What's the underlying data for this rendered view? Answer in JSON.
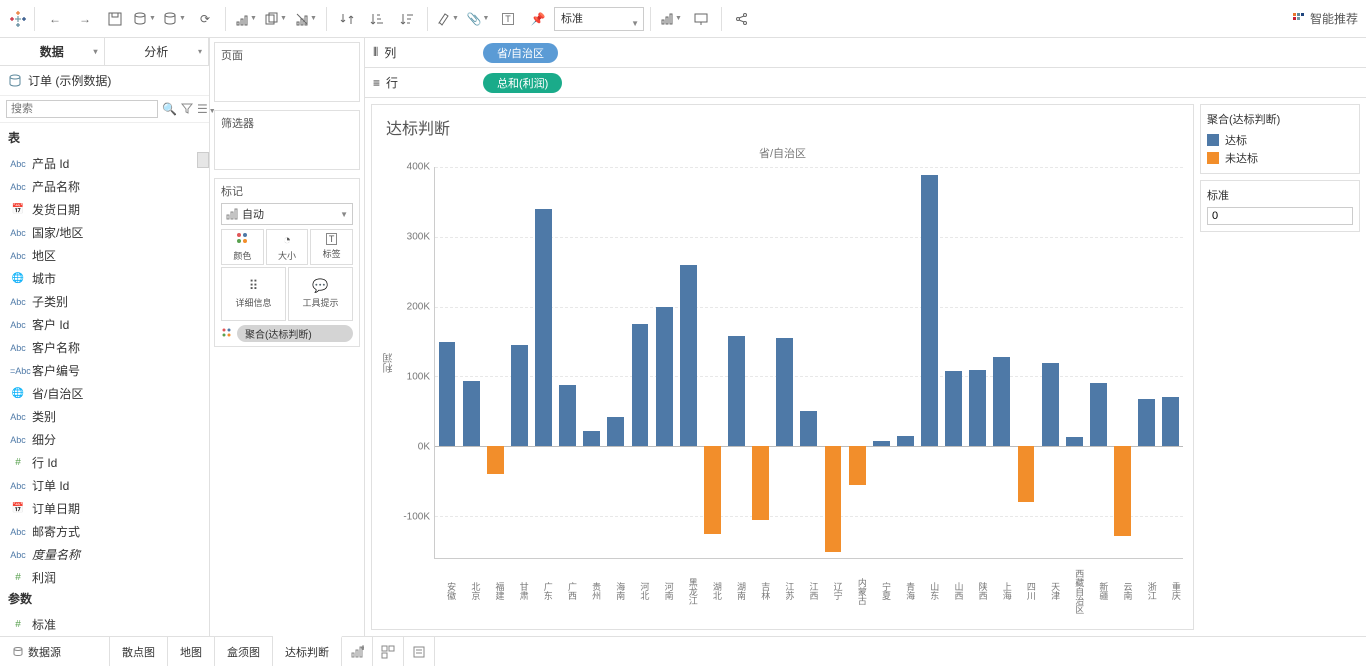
{
  "toolbar": {
    "fit_select": "标准",
    "smart_rec": "智能推荐"
  },
  "left": {
    "tab_data": "数据",
    "tab_analysis": "分析",
    "datasource": "订单 (示例数据)",
    "search_placeholder": "搜索",
    "tables_header": "表",
    "fields": [
      {
        "icon": "abc",
        "label": "产品 Id"
      },
      {
        "icon": "abc",
        "label": "产品名称"
      },
      {
        "icon": "date",
        "label": "发货日期"
      },
      {
        "icon": "abc",
        "label": "国家/地区"
      },
      {
        "icon": "abc",
        "label": "地区"
      },
      {
        "icon": "globe",
        "label": "城市"
      },
      {
        "icon": "abc",
        "label": "子类别"
      },
      {
        "icon": "abc",
        "label": "客户 Id"
      },
      {
        "icon": "abc",
        "label": "客户名称"
      },
      {
        "icon": "abc-calc",
        "label": "客户编号"
      },
      {
        "icon": "globe",
        "label": "省/自治区"
      },
      {
        "icon": "abc",
        "label": "类别"
      },
      {
        "icon": "abc",
        "label": "细分"
      },
      {
        "icon": "hash",
        "label": "行 Id"
      },
      {
        "icon": "abc",
        "label": "订单 Id"
      },
      {
        "icon": "date",
        "label": "订单日期"
      },
      {
        "icon": "abc",
        "label": "邮寄方式"
      },
      {
        "icon": "abc",
        "label": "度量名称",
        "italic": true
      },
      {
        "icon": "hash",
        "label": "利润"
      }
    ],
    "params_header": "参数",
    "params": [
      {
        "icon": "hash",
        "label": "标准"
      }
    ]
  },
  "mid": {
    "pages": "页面",
    "filters": "筛选器",
    "marks": "标记",
    "mark_type": "自动",
    "mark_buttons": {
      "color": "颜色",
      "size": "大小",
      "label": "标签",
      "detail": "详细信息",
      "tooltip": "工具提示"
    },
    "color_pill": "聚合(达标判断)"
  },
  "shelves": {
    "columns_label": "列",
    "rows_label": "行",
    "columns_pill": "省/自治区",
    "rows_pill": "总和(利润)"
  },
  "chart_data": {
    "type": "bar",
    "title": "达标判断",
    "axis_title_top": "省/自治区",
    "ylabel": "利润",
    "ylim": [
      -160000,
      400000
    ],
    "yticks": [
      -100000,
      0,
      100000,
      200000,
      300000,
      400000
    ],
    "ytick_labels": [
      "-100K",
      "0K",
      "100K",
      "200K",
      "300K",
      "400K"
    ],
    "categories": [
      "安徽",
      "北京",
      "福建",
      "甘肃",
      "广东",
      "广西",
      "贵州",
      "海南",
      "河北",
      "河南",
      "黑龙江",
      "湖北",
      "湖南",
      "吉林",
      "江苏",
      "江西",
      "辽宁",
      "内蒙古",
      "宁夏",
      "青海",
      "山东",
      "山西",
      "陕西",
      "上海",
      "四川",
      "天津",
      "西藏自治区",
      "新疆",
      "云南",
      "浙江",
      "重庆"
    ],
    "values": [
      150000,
      93000,
      -40000,
      145000,
      340000,
      88000,
      22000,
      42000,
      175000,
      200000,
      260000,
      -125000,
      158000,
      -105000,
      155000,
      50000,
      -152000,
      -55000,
      8000,
      15000,
      388000,
      108000,
      110000,
      128000,
      -80000,
      120000,
      14000,
      90000,
      -128000,
      68000,
      70000
    ],
    "legend_title": "聚合(达标判断)",
    "legend": [
      {
        "label": "达标",
        "color": "#4e79a7"
      },
      {
        "label": "未达标",
        "color": "#f28e2b"
      }
    ],
    "param_card_title": "标准",
    "param_value": "0"
  },
  "bottom": {
    "datasource": "数据源",
    "tabs": [
      "散点图",
      "地图",
      "盒须图",
      "达标判断"
    ],
    "active": "达标判断"
  }
}
